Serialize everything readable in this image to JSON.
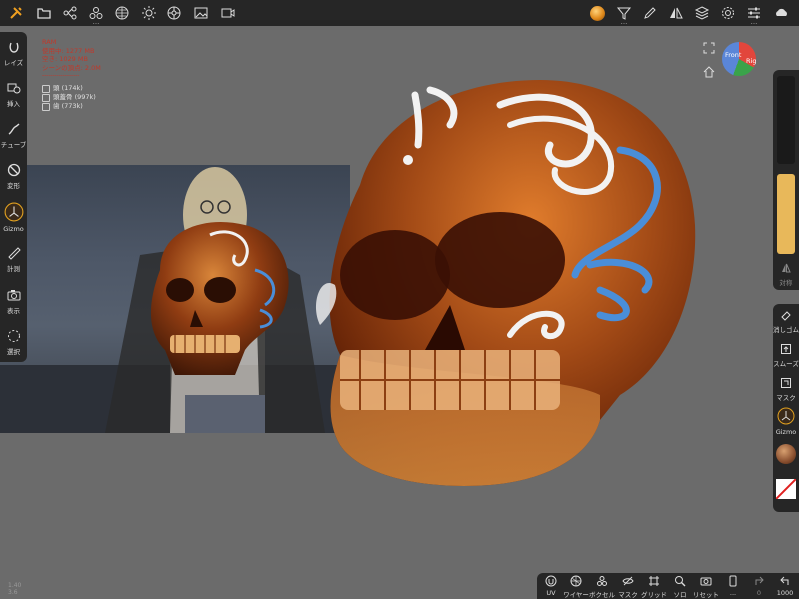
{
  "top_toolbar": {
    "icons": [
      "tools-icon",
      "folder-icon",
      "scene-graph-icon",
      "primitives-icon",
      "material-globe-icon",
      "light-icon",
      "settings-wheel-icon",
      "image-icon",
      "video-icon",
      "material-ball-icon",
      "filter-icon",
      "pen-icon",
      "symmetry-icon",
      "layers-icon",
      "gear-icon",
      "sliders-icon",
      "cloud-icon"
    ]
  },
  "left_panel": {
    "items": [
      {
        "label": "レイズ",
        "icon": "raise-icon"
      },
      {
        "label": "挿入",
        "icon": "insert-icon"
      },
      {
        "label": "チューブ",
        "icon": "tube-icon"
      },
      {
        "label": "変形",
        "icon": "deform-icon"
      },
      {
        "label": "Gizmo",
        "icon": "gizmo-icon"
      },
      {
        "label": "計測",
        "icon": "ruler-icon"
      },
      {
        "label": "表示",
        "icon": "camera-icon"
      },
      {
        "label": "選択",
        "icon": "select-icon"
      }
    ]
  },
  "stats": {
    "title": "RAM",
    "used": "使用中: 1277 MB",
    "free": "空き: 1029 MB",
    "scene": "シーンの頂点: 2.0M",
    "separator": "- - - - - - - - - - - - - - - - - -"
  },
  "meshes": [
    {
      "name": "頭 (174k)"
    },
    {
      "name": "頭蓋骨 (997k)"
    },
    {
      "name": "歯 (773k)"
    }
  ],
  "right_panel_top": {
    "symmetry_label": "対称"
  },
  "right_panel_bottom": {
    "items": [
      {
        "label": "消しゴム",
        "icon": "eraser-icon"
      },
      {
        "label": "スムーズ",
        "icon": "smooth-icon"
      },
      {
        "label": "マスク",
        "icon": "mask-icon"
      },
      {
        "label": "Gizmo",
        "icon": "gizmo-icon"
      }
    ]
  },
  "bottom_toolbar": {
    "items": [
      {
        "label": "UV",
        "icon": "uv-icon"
      },
      {
        "label": "ワイヤー",
        "icon": "wireframe-icon"
      },
      {
        "label": "ボクセル",
        "icon": "voxel-icon"
      },
      {
        "label": "マスク",
        "icon": "mask-hidden-icon"
      },
      {
        "label": "グリッド",
        "icon": "grid-icon"
      },
      {
        "label": "ソロ",
        "icon": "solo-search-icon"
      },
      {
        "label": "リセット",
        "icon": "reset-camera-icon"
      },
      {
        "label": "...",
        "icon": "phone-icon"
      }
    ],
    "redo": "0",
    "undo": "1000"
  },
  "corner": {
    "line1": "1.40",
    "line2": "3.6"
  },
  "gizmo_cube": {
    "front": "Front",
    "right": "Rig"
  },
  "colors": {
    "accent": "#e0a020",
    "panel": "#262626",
    "viewport": "#6b6b6b",
    "stats_text": "#c0392b",
    "skull": "#b8581a",
    "glaze": "#f0f0f0",
    "blue": "#4a8ed8"
  }
}
